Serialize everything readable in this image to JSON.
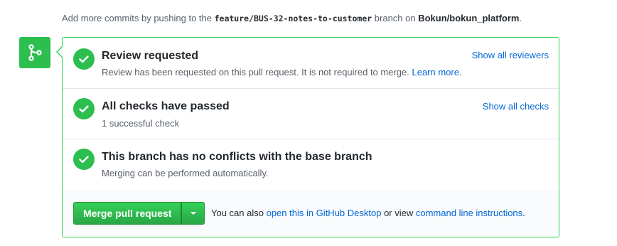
{
  "push_note": {
    "prefix": "Add more commits by pushing to the ",
    "branch": "feature/BUS-32-notes-to-customer",
    "middle": " branch on ",
    "repo": "Bokun/bokun_platform",
    "suffix": "."
  },
  "review": {
    "title": "Review requested",
    "description": "Review has been requested on this pull request. It is not required to merge. ",
    "learn_more": "Learn more.",
    "action": "Show all reviewers"
  },
  "checks": {
    "title": "All checks have passed",
    "description": "1 successful check",
    "action": "Show all checks"
  },
  "conflicts": {
    "title": "This branch has no conflicts with the base branch",
    "description": "Merging can be performed automatically."
  },
  "merge": {
    "button_label": "Merge pull request",
    "alt_prefix": "You can also ",
    "desktop_link": "open this in GitHub Desktop",
    "alt_middle": " or view ",
    "cli_link": "command line instructions",
    "alt_suffix": "."
  },
  "colors": {
    "success": "#2cbe4e",
    "border_success": "#34d058",
    "link": "#0366d6"
  },
  "icons": {
    "badge": "git-merge-icon",
    "status": "check-icon",
    "dropdown": "caret-down-icon"
  }
}
